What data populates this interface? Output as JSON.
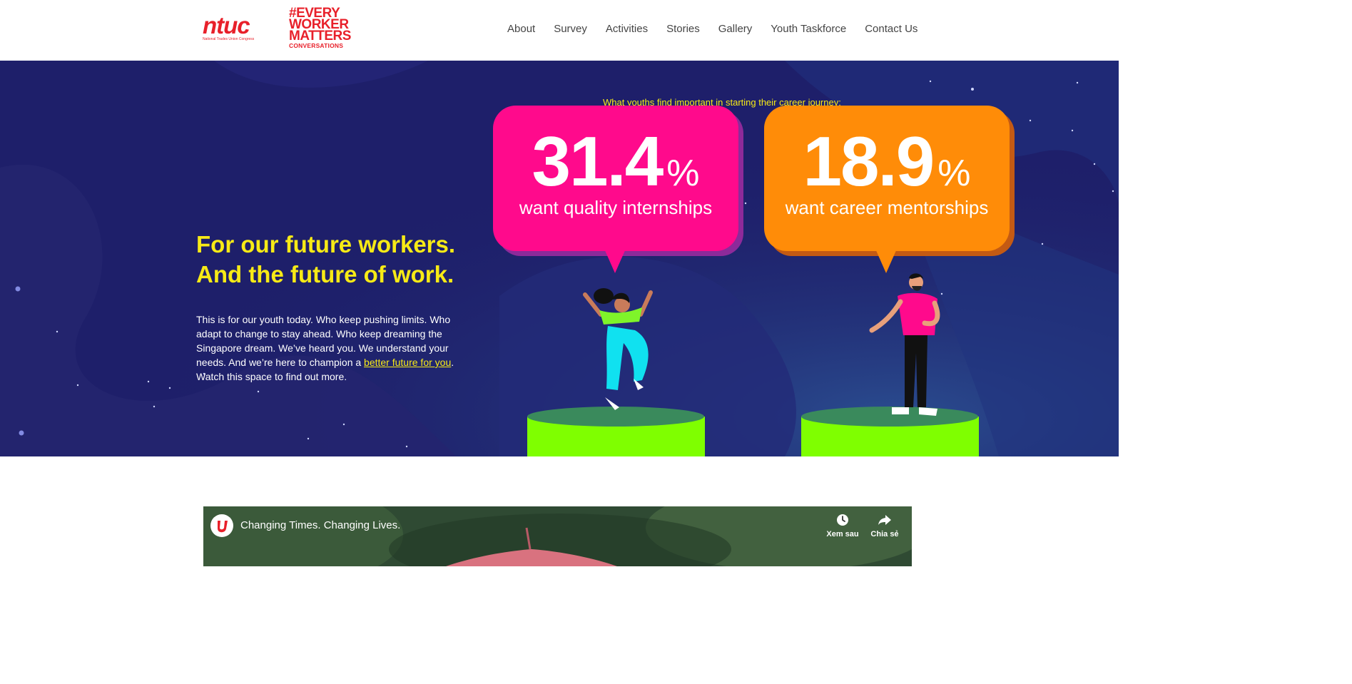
{
  "header": {
    "logo_ntuc": {
      "text": "ntuc",
      "subtitle": "National Trades Union Congress"
    },
    "logo_campaign": {
      "lines": [
        "#EVERY",
        "WORKER",
        "MATTERS",
        "CONVERSATIONS"
      ]
    },
    "nav": [
      "About",
      "Survey",
      "Activities",
      "Stories",
      "Gallery",
      "Youth Taskforce",
      "Contact Us"
    ]
  },
  "hero": {
    "headline_line1": "For our future workers.",
    "headline_line2": "And the future of work.",
    "paragraph_before_link": "This is for our youth today. Who keep pushing limits. Who adapt to change to stay ahead. Who keep dreaming the Singapore dream. We’ve heard you. We understand your needs. And we’re here to champion a ",
    "paragraph_link": "better future for you",
    "paragraph_after_link": ". Watch this space to find out more.",
    "stats_caption": "What youths find important in starting their career journey:",
    "stats": [
      {
        "value": "31.4",
        "unit": "%",
        "label": "want quality internships",
        "color": "#ff0a8c"
      },
      {
        "value": "18.9",
        "unit": "%",
        "label": "want career mentorships",
        "color": "#ff8c08"
      }
    ],
    "colors": {
      "background": "#1e1f6a",
      "accent_yellow": "#f7ea16",
      "podium_top": "#3a8a5c",
      "podium_side": "#7fff00"
    }
  },
  "video": {
    "title": "Changing Times. Changing Lives.",
    "channel_icon": "ntuc-u-icon",
    "controls": [
      {
        "icon": "clock-icon",
        "label": "Xem sau"
      },
      {
        "icon": "share-arrow-icon",
        "label": "Chia sẻ"
      }
    ]
  }
}
